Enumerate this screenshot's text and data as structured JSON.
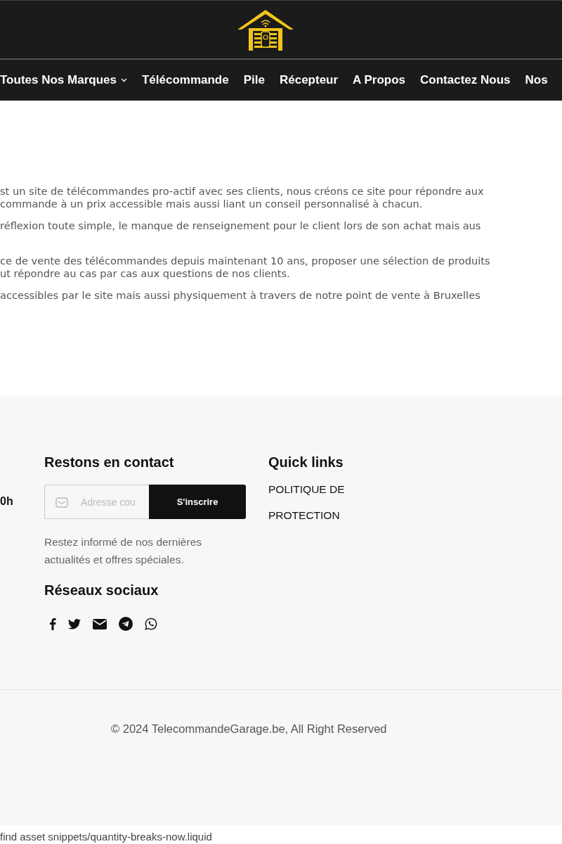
{
  "nav": [
    {
      "label": "Toutes Nos Marques",
      "dropdown": true
    },
    {
      "label": "Télécommande",
      "dropdown": false
    },
    {
      "label": "Pile",
      "dropdown": false
    },
    {
      "label": "Récepteur",
      "dropdown": false
    },
    {
      "label": "A Propos",
      "dropdown": false
    },
    {
      "label": "Contactez Nous",
      "dropdown": false
    },
    {
      "label": "Nos",
      "dropdown": false
    }
  ],
  "paragraphs": [
    [
      "st un site de télécommandes pro-actif avec ses clients, nous créons ce site pour répondre aux",
      "commande à un prix accessible mais aussi liant un conseil personnalisé à chacun."
    ],
    [
      "réflexion toute simple, le manque de renseignement pour le client lors de son achat mais aus"
    ],
    [
      "ce de vente des télécommandes depuis maintenant 10 ans, proposer une sélection de produits",
      "ut répondre au cas par cas aux questions de nos clients."
    ],
    [
      "accessibles par le site mais aussi physiquement à travers de notre point de vente à Bruxelles"
    ]
  ],
  "footer": {
    "left_fragment": "0h",
    "contact": {
      "heading": "Restons en contact",
      "email_placeholder": "Adresse cou",
      "button": "S'inscrire",
      "note": "Restez informé de nos dernières actualités et offres spéciales."
    },
    "social": {
      "heading": "Réseaux sociaux",
      "icons": [
        {
          "kind": "facebook"
        },
        {
          "kind": "twitter"
        },
        {
          "kind": "email"
        },
        {
          "kind": "telegram"
        },
        {
          "kind": "whatsapp"
        }
      ]
    },
    "quick_links": {
      "heading": "Quick links",
      "links": [
        "POLITIQUE DE",
        "PROTECTION"
      ]
    },
    "copyright": "© 2024 TelecommandeGarage.be, All Right Reserved"
  },
  "error_bar": "find asset snippets/quantity-breaks-now.liquid"
}
